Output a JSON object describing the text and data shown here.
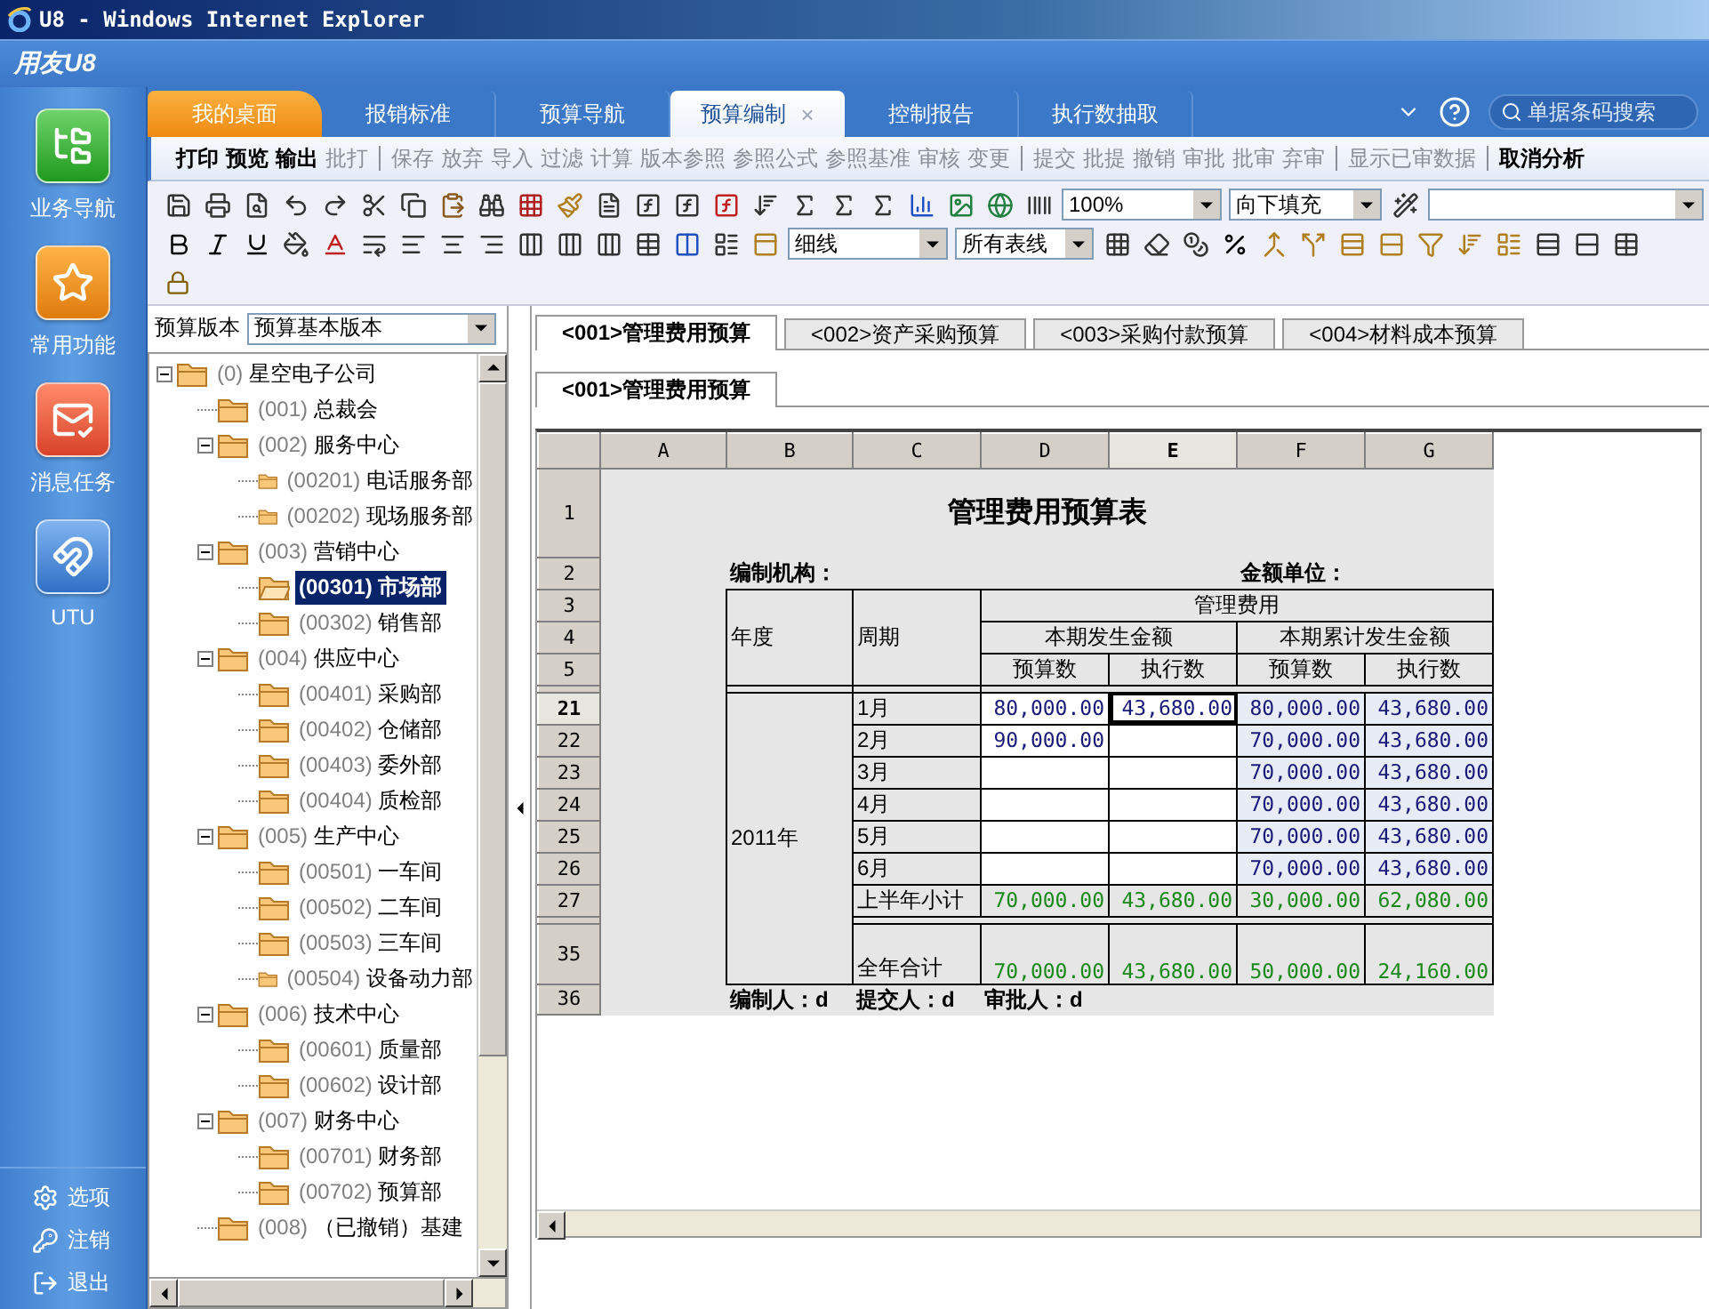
{
  "window": {
    "title": "U8 - Windows Internet Explorer"
  },
  "app": {
    "title": "用友U8"
  },
  "sidebar": {
    "items": [
      {
        "label": "业务导航",
        "kind": "nav"
      },
      {
        "label": "常用功能",
        "kind": "favorites"
      },
      {
        "label": "消息任务",
        "kind": "messages"
      },
      {
        "label": "UTU",
        "kind": "utu"
      }
    ],
    "footer": [
      {
        "label": "选项",
        "kind": "options"
      },
      {
        "label": "注销",
        "kind": "logoff"
      },
      {
        "label": "退出",
        "kind": "exit"
      }
    ]
  },
  "tabs": [
    {
      "label": "我的桌面",
      "kind": "home",
      "selected": false
    },
    {
      "label": "报销标准",
      "kind": "page",
      "selected": false
    },
    {
      "label": "预算导航",
      "kind": "page",
      "selected": false
    },
    {
      "label": "预算编制",
      "kind": "page",
      "selected": true,
      "close": "×"
    },
    {
      "label": "控制报告",
      "kind": "page",
      "selected": false
    },
    {
      "label": "执行数抽取",
      "kind": "page",
      "selected": false
    }
  ],
  "search": {
    "placeholder": "单据条码搜索"
  },
  "menu": {
    "groups": [
      [
        {
          "label": "打印",
          "disabled": false
        },
        {
          "label": "预览",
          "disabled": false
        },
        {
          "label": "输出",
          "disabled": false
        },
        {
          "label": "批打",
          "disabled": true
        }
      ],
      [
        {
          "label": "保存",
          "disabled": true
        },
        {
          "label": "放弃",
          "disabled": true
        },
        {
          "label": "导入",
          "disabled": true
        },
        {
          "label": "过滤",
          "disabled": true
        },
        {
          "label": "计算",
          "disabled": true
        },
        {
          "label": "版本参照",
          "disabled": true
        },
        {
          "label": "参照公式",
          "disabled": true
        },
        {
          "label": "参照基准",
          "disabled": true
        },
        {
          "label": "审核",
          "disabled": true
        },
        {
          "label": "变更",
          "disabled": true
        }
      ],
      [
        {
          "label": "提交",
          "disabled": true
        },
        {
          "label": "批提",
          "disabled": true
        },
        {
          "label": "撤销",
          "disabled": true
        },
        {
          "label": "审批",
          "disabled": true
        },
        {
          "label": "批审",
          "disabled": true
        },
        {
          "label": "弃审",
          "disabled": true
        }
      ],
      [
        {
          "label": "显示已审数据",
          "disabled": true
        }
      ],
      [
        {
          "label": "取消分析",
          "disabled": false
        }
      ]
    ]
  },
  "toolbar": {
    "zoom": "100%",
    "fill": "向下填充",
    "line": "细线",
    "borders": "所有表线"
  },
  "version": {
    "label": "预算版本",
    "value": "预算基本版本"
  },
  "tree": [
    {
      "code": "(0)",
      "name": "星空电子公司",
      "expanded": true,
      "selected": false,
      "children": [
        {
          "code": "(001)",
          "name": "总裁会",
          "selected": false
        },
        {
          "code": "(002)",
          "name": "服务中心",
          "expanded": true,
          "selected": false,
          "children": [
            {
              "code": "(00201)",
              "name": "电话服务部",
              "selected": false
            },
            {
              "code": "(00202)",
              "name": "现场服务部",
              "selected": false
            }
          ]
        },
        {
          "code": "(003)",
          "name": "营销中心",
          "expanded": true,
          "selected": false,
          "children": [
            {
              "code": "(00301)",
              "name": "市场部",
              "selected": true
            },
            {
              "code": "(00302)",
              "name": "销售部",
              "selected": false
            }
          ]
        },
        {
          "code": "(004)",
          "name": "供应中心",
          "expanded": true,
          "selected": false,
          "children": [
            {
              "code": "(00401)",
              "name": "采购部",
              "selected": false
            },
            {
              "code": "(00402)",
              "name": "仓储部",
              "selected": false
            },
            {
              "code": "(00403)",
              "name": "委外部",
              "selected": false
            },
            {
              "code": "(00404)",
              "name": "质检部",
              "selected": false
            }
          ]
        },
        {
          "code": "(005)",
          "name": "生产中心",
          "expanded": true,
          "selected": false,
          "children": [
            {
              "code": "(00501)",
              "name": "一车间",
              "selected": false
            },
            {
              "code": "(00502)",
              "name": "二车间",
              "selected": false
            },
            {
              "code": "(00503)",
              "name": "三车间",
              "selected": false
            },
            {
              "code": "(00504)",
              "name": "设备动力部",
              "selected": false
            }
          ]
        },
        {
          "code": "(006)",
          "name": "技术中心",
          "expanded": true,
          "selected": false,
          "children": [
            {
              "code": "(00601)",
              "name": "质量部",
              "selected": false
            },
            {
              "code": "(00602)",
              "name": "设计部",
              "selected": false
            }
          ]
        },
        {
          "code": "(007)",
          "name": "财务中心",
          "expanded": true,
          "selected": false,
          "children": [
            {
              "code": "(00701)",
              "name": "财务部",
              "selected": false
            },
            {
              "code": "(00702)",
              "name": "预算部",
              "selected": false
            }
          ]
        },
        {
          "code": "(008)",
          "name": "（已撤销）基建",
          "selected": false
        }
      ]
    }
  ],
  "sheet_tabs": [
    {
      "label": "<001>管理费用预算",
      "selected": true
    },
    {
      "label": "<002>资产采购预算",
      "selected": false
    },
    {
      "label": "<003>采购付款预算",
      "selected": false
    },
    {
      "label": "<004>材料成本预算",
      "selected": false
    }
  ],
  "sub_tabs": [
    {
      "label": "<001>管理费用预算",
      "selected": true
    }
  ],
  "sheet": {
    "columns": [
      {
        "label": "A",
        "selected": false
      },
      {
        "label": "B",
        "selected": false
      },
      {
        "label": "C",
        "selected": false
      },
      {
        "label": "D",
        "selected": false
      },
      {
        "label": "E",
        "selected": true
      },
      {
        "label": "F",
        "selected": false
      },
      {
        "label": "G",
        "selected": false
      }
    ],
    "title": "管理费用预算表",
    "org_label": "编制机构：",
    "unit_label": "金额单位：",
    "header_rows": [
      {
        "num": "1",
        "selected": false
      },
      {
        "num": "2",
        "selected": false
      },
      {
        "num": "3",
        "selected": false
      },
      {
        "num": "4",
        "selected": false
      },
      {
        "num": "5",
        "selected": false
      }
    ],
    "head": {
      "year": "年度",
      "period": "周期",
      "group": "管理费用",
      "current": "本期发生金额",
      "cumulative": "本期累计发生金额",
      "cols": [
        "预算数",
        "执行数",
        "预算数",
        "执行数"
      ]
    },
    "year_value": "2011年",
    "rows": [
      {
        "num": "21",
        "selected": true,
        "kind": "month",
        "period": "1月",
        "values": {
          "d": "80,000.00",
          "e": "43,680.00",
          "f": "80,000.00",
          "g": "43,680.00"
        }
      },
      {
        "num": "22",
        "selected": false,
        "kind": "month",
        "period": "2月",
        "values": {
          "d": "90,000.00",
          "f": "70,000.00",
          "g": "43,680.00"
        }
      },
      {
        "num": "23",
        "selected": false,
        "kind": "month",
        "period": "3月",
        "values": {
          "f": "70,000.00",
          "g": "43,680.00"
        }
      },
      {
        "num": "24",
        "selected": false,
        "kind": "month",
        "period": "4月",
        "values": {
          "f": "70,000.00",
          "g": "43,680.00"
        }
      },
      {
        "num": "25",
        "selected": false,
        "kind": "month",
        "period": "5月",
        "values": {
          "f": "70,000.00",
          "g": "43,680.00"
        }
      },
      {
        "num": "26",
        "selected": false,
        "kind": "month",
        "period": "6月",
        "values": {
          "f": "70,000.00",
          "g": "43,680.00"
        }
      },
      {
        "num": "27",
        "selected": false,
        "kind": "total",
        "period": "上半年小计",
        "values": {
          "d": "70,000.00",
          "e": "43,680.00",
          "f": "30,000.00",
          "g": "62,080.00"
        }
      }
    ],
    "total_row": {
      "num": "35",
      "selected": false,
      "kind": "total",
      "period": "全年合计",
      "values": {
        "d": "70,000.00",
        "e": "43,680.00",
        "f": "50,000.00",
        "g": "24,160.00"
      }
    },
    "footer_row": {
      "num": "36",
      "selected": false,
      "cells": [
        "编制人：d",
        "提交人：d",
        "审批人：d"
      ]
    }
  }
}
